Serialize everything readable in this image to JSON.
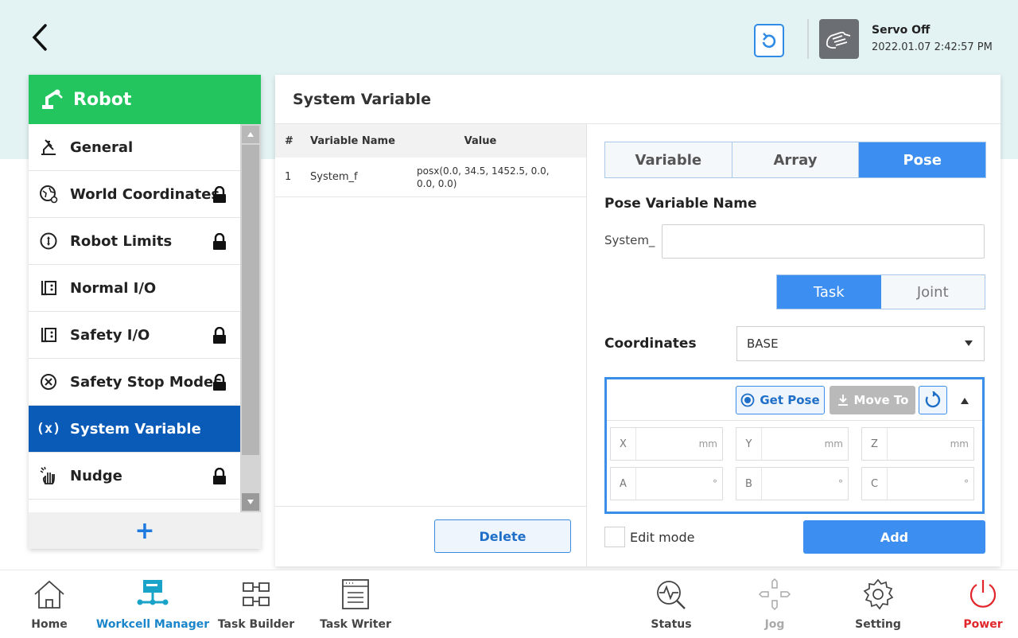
{
  "header": {
    "servo_status": "Servo Off",
    "timestamp": "2022.01.07 2:42:57 PM"
  },
  "sidebar": {
    "title": "Robot",
    "items": [
      {
        "label": "General",
        "icon": "general-icon",
        "locked": false
      },
      {
        "label": "World Coordinates",
        "icon": "world-coordinates-icon",
        "locked": true
      },
      {
        "label": "Robot Limits",
        "icon": "robot-limits-icon",
        "locked": true
      },
      {
        "label": "Normal I/O",
        "icon": "io-icon",
        "locked": false
      },
      {
        "label": "Safety I/O",
        "icon": "io-icon",
        "locked": true
      },
      {
        "label": "Safety Stop Modes",
        "icon": "stop-icon",
        "locked": true
      },
      {
        "label": "System Variable",
        "icon": "variable-icon",
        "locked": false,
        "active": true
      },
      {
        "label": "Nudge",
        "icon": "nudge-icon",
        "locked": true
      }
    ],
    "add_label": "+"
  },
  "main": {
    "title": "System Variable",
    "table": {
      "columns": [
        "#",
        "Variable Name",
        "Value"
      ],
      "rows": [
        {
          "num": "1",
          "name": "System_f",
          "value": "posx(0.0, 34.5, 1452.5, 0.0, 0.0, 0.0)"
        }
      ]
    },
    "delete_label": "Delete",
    "type_tabs": [
      {
        "label": "Variable",
        "selected": false
      },
      {
        "label": "Array",
        "selected": false
      },
      {
        "label": "Pose",
        "selected": true
      }
    ],
    "pose_name_label": "Pose Variable Name",
    "pose_name_prefix": "System_",
    "pose_name_value": "",
    "space_tabs": [
      {
        "label": "Task",
        "selected": true
      },
      {
        "label": "Joint",
        "selected": false
      }
    ],
    "coordinates_label": "Coordinates",
    "coordinates_value": "BASE",
    "get_pose_label": "Get Pose",
    "move_to_label": "Move To",
    "pose_fields": [
      {
        "axis": "X",
        "unit": "mm"
      },
      {
        "axis": "Y",
        "unit": "mm"
      },
      {
        "axis": "Z",
        "unit": "mm"
      },
      {
        "axis": "A",
        "unit": "°"
      },
      {
        "axis": "B",
        "unit": "°"
      },
      {
        "axis": "C",
        "unit": "°"
      }
    ],
    "edit_mode_label": "Edit mode",
    "edit_mode_checked": false,
    "add_label": "Add"
  },
  "bottom_nav": [
    {
      "label": "Home",
      "icon": "home-icon",
      "color": "#444444"
    },
    {
      "label": "Workcell Manager",
      "icon": "workcell-manager-icon",
      "color": "#1aa3c9",
      "active": true
    },
    {
      "label": "Task Builder",
      "icon": "task-builder-icon",
      "color": "#444444"
    },
    {
      "label": "Task Writer",
      "icon": "task-writer-icon",
      "color": "#444444"
    },
    {
      "label": "Status",
      "icon": "status-icon",
      "color": "#444444"
    },
    {
      "label": "Jog",
      "icon": "jog-icon",
      "color": "#aaaaaa"
    },
    {
      "label": "Setting",
      "icon": "setting-icon",
      "color": "#444444"
    },
    {
      "label": "Power",
      "icon": "power-icon",
      "color": "#e0262b"
    }
  ],
  "colors": {
    "accent_green": "#22c55e",
    "active_item": "#0a5ab8",
    "primary_blue": "#3c8ff0",
    "power_red": "#e0262b"
  }
}
